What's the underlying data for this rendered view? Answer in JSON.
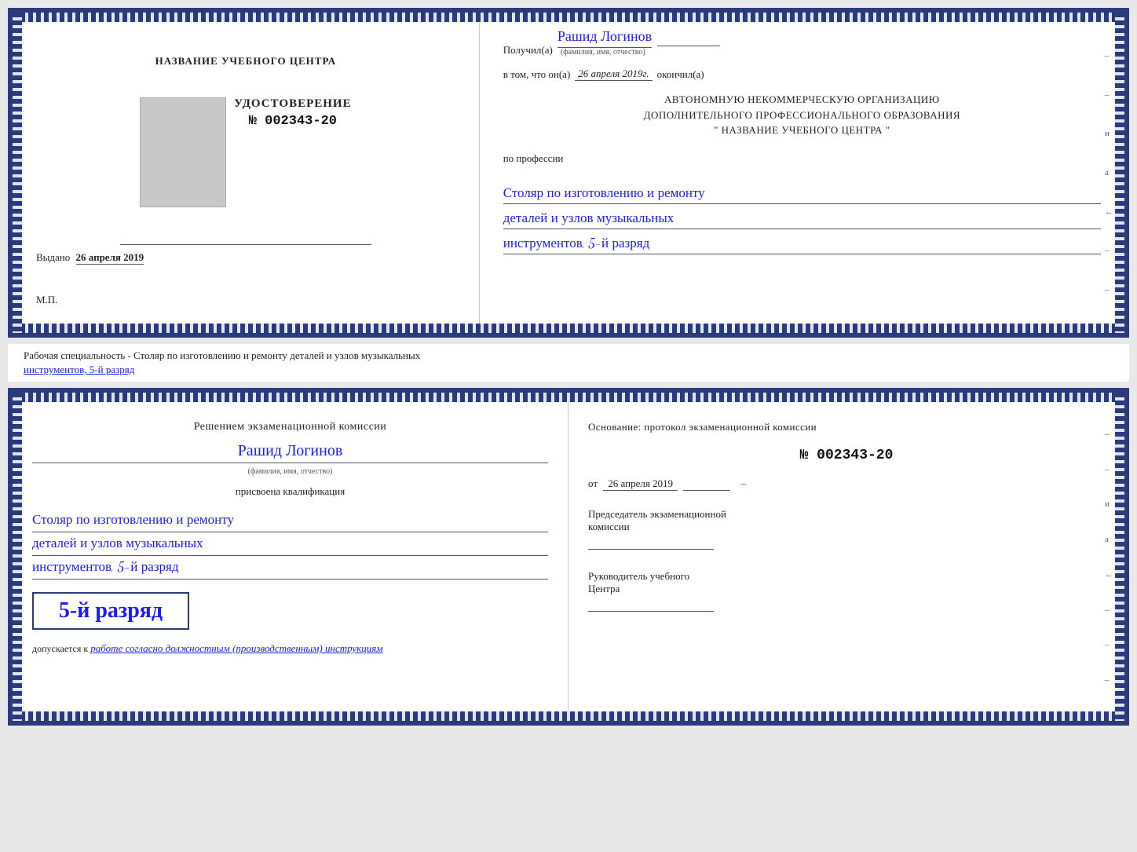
{
  "top_doc": {
    "left": {
      "center_title": "НАЗВАНИЕ УЧЕБНОГО ЦЕНТРА",
      "udostoverenie": "УДОСТОВЕРЕНИЕ",
      "number": "№ 002343-20",
      "vydano_label": "Выдано",
      "vydano_date": "26 апреля 2019",
      "mp": "М.П."
    },
    "right": {
      "poluchil_prefix": "Получил(а)",
      "recipient_name": "Рашид Логинов",
      "fio_label": "(фамилия, имя, отчество)",
      "vtom_prefix": "в том, что он(а)",
      "date_value": "26 апреля 2019г.",
      "okonchil": "окончил(а)",
      "org_line1": "АВТОНОМНУЮ НЕКОММЕРЧЕСКУЮ ОРГАНИЗАЦИЮ",
      "org_line2": "ДОПОЛНИТЕЛЬНОГО ПРОФЕССИОНАЛЬНОГО ОБРАЗОВАНИЯ",
      "org_quote": "\"  НАЗВАНИЕ УЧЕБНОГО ЦЕНТРА  \"",
      "po_professii": "по профессии",
      "prof_line1": "Столяр по изготовлению и ремонту",
      "prof_line2": "деталей и узлов музыкальных",
      "prof_line3": "инструментов, 5-й разряд"
    }
  },
  "middle_label": {
    "text_prefix": "Рабочая специальность - Столяр по изготовлению и ремонту деталей и узлов музыкальных",
    "text_underline": "инструментов, 5-й разряд"
  },
  "bottom_doc": {
    "left": {
      "resheniem": "Решением экзаменационной комиссии",
      "name": "Рашид Логинов",
      "fio_label": "(фамилия, имя, отчество)",
      "prisvoena": "присвоена квалификация",
      "qual_line1": "Столяр по изготовлению и ремонту",
      "qual_line2": "деталей и узлов музыкальных",
      "qual_line3": "инструментов, 5-й разряд",
      "razryad_box": "5-й разряд",
      "dopuskaetsya_prefix": "допускается к",
      "dopuskaetsya_text": "работе согласно должностным (производственным) инструкциям"
    },
    "right": {
      "osnov_text": "Основание: протокол экзаменационной комиссии",
      "protocol_number": "№  002343-20",
      "ot_label": "от",
      "ot_date": "26 апреля 2019",
      "predsedatel_line1": "Председатель экзаменационной",
      "predsedatel_line2": "комиссии",
      "rukovoditel_line1": "Руководитель учебного",
      "rukovoditel_line2": "Центра"
    }
  }
}
